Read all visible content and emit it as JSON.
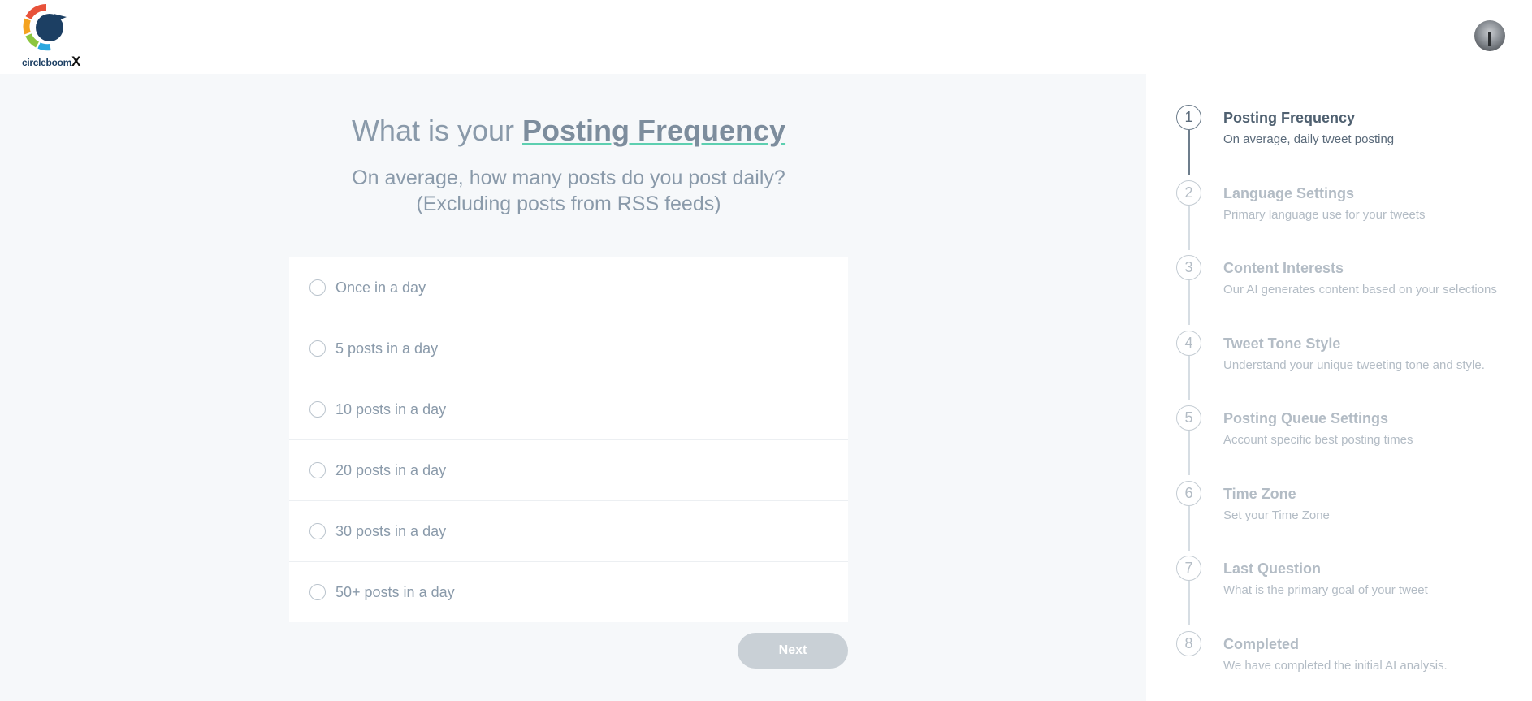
{
  "header": {
    "logo_text": "circleboom",
    "logo_suffix": "X"
  },
  "question": {
    "title_prefix": "What is your ",
    "title_highlight": "Posting Frequency",
    "subtitle_line1": "On average, how many posts do you post daily?",
    "subtitle_line2": "(Excluding posts from RSS feeds)"
  },
  "options": [
    {
      "label": "Once in a day"
    },
    {
      "label": "5 posts in a day"
    },
    {
      "label": "10 posts in a day"
    },
    {
      "label": "20 posts in a day"
    },
    {
      "label": "30 posts in a day"
    },
    {
      "label": "50+ posts in a day"
    }
  ],
  "next_label": "Next",
  "steps": [
    {
      "number": "1",
      "title": "Posting Frequency",
      "desc": "On average, daily tweet posting"
    },
    {
      "number": "2",
      "title": "Language Settings",
      "desc": "Primary language use for your tweets"
    },
    {
      "number": "3",
      "title": "Content Interests",
      "desc": "Our AI generates content based on your selections"
    },
    {
      "number": "4",
      "title": "Tweet Tone Style",
      "desc": "Understand your unique tweeting tone and style."
    },
    {
      "number": "5",
      "title": "Posting Queue Settings",
      "desc": "Account specific best posting times"
    },
    {
      "number": "6",
      "title": "Time Zone",
      "desc": "Set your Time Zone"
    },
    {
      "number": "7",
      "title": "Last Question",
      "desc": "What is the primary goal of your tweet"
    },
    {
      "number": "8",
      "title": "Completed",
      "desc": "We have completed the initial AI analysis."
    }
  ],
  "active_step": 1,
  "colors": {
    "accent_underline": "#5dcfb0",
    "next_disabled": "#c9d0d6",
    "text_muted": "#8a9aaa"
  }
}
